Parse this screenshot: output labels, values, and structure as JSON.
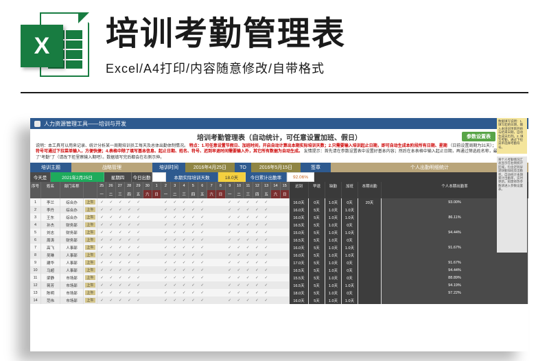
{
  "header": {
    "title": "培训考勤管理表",
    "subtitle": "Excel/A4打印/内容随意修改/自带格式",
    "badge": "X"
  },
  "ribbon": {
    "text": "人力资源管理工具——培训与开发"
  },
  "doc": {
    "title": "培训考勤管理表（自动统计，可任意设置加班、假日）",
    "param_btn": "参数设置表",
    "desc_prefix": "说明：本工具可以用来记录、统计分析某一周期培训员工每天及总体出勤体制情况。",
    "desc_bold": "特点：1.可任意设置节假日、加班时间，开启自动计算出本期实际培训天数；2.只需要输入培训起止日期，即可自动生成本阶段所有日期、星期",
    "desc_mid": "（日前设置周期为31天）；",
    "desc_bold2": "3.姓名、考勤符号可通过下拉菜单输入，方便快捷；4.表格中除了填写基本信息、起止日期、姓名、符号、迟到早退时间需要输入外，其它所有数据为自动生成。",
    "desc_tail": "友情提示：首先请在参数设置表中设置好基本内容；然后在本表格中输入起止日期，再通过筛选姓名称，最后因温情记住了\"考勤\"了（请改下拒里察输入期吧）。数据填写完后都会在右侧示伸。"
  },
  "bands": {
    "topic": "培训主题",
    "plan": "战略管理",
    "time": "培训时间",
    "start": "2016年4月25日",
    "to": "TO",
    "end": "2016年5月15日",
    "sign": "签章",
    "stats": "个人出勤明细统计"
  },
  "dates": {
    "today_lbl": "今天是",
    "today": "2021年2月25日",
    "weekday": "星期四",
    "today_att": "今日出勤",
    "month_actual": "本期实际培训天数",
    "days": "18.0天",
    "rate_lbl": "今日累计出勤率",
    "rate": "92.06%"
  },
  "cols": {
    "idx": "序号",
    "name": "姓名",
    "dept": "部门名称",
    "days_hdr": [
      "25",
      "26",
      "27",
      "28",
      "29",
      "30",
      "1",
      "2",
      "3",
      "4",
      "5",
      "6",
      "7",
      "8",
      "9",
      "10",
      "11",
      "12",
      "13",
      "14",
      "15"
    ],
    "wk": [
      "一",
      "二",
      "三",
      "四",
      "五",
      "六",
      "日",
      "一",
      "二",
      "三",
      "四",
      "五",
      "六",
      "日",
      "一",
      "二",
      "三",
      "四",
      "五",
      "六",
      "日"
    ],
    "late": "迟到",
    "early": "早退",
    "absent": "缺勤",
    "ot": "加班",
    "actual": "本期出勤",
    "prate": "个人本期出勤率"
  },
  "rows": [
    {
      "idx": "1",
      "name": "李兰",
      "dept": "综合办",
      "tag": "上午",
      "late": "16.0天",
      "early": "0天",
      "absent": "1.0天",
      "ot": "0天",
      "actual": "20天",
      "rate": "93.00%"
    },
    {
      "idx": "2",
      "name": "李丹",
      "dept": "综合办",
      "tag": "上午",
      "late": "16.0天",
      "early": "5天",
      "absent": "1.0天",
      "ot": "1.0天",
      "actual": "",
      "rate": ""
    },
    {
      "idx": "3",
      "name": "王东",
      "dept": "综合办",
      "tag": "上午",
      "late": "16.0天",
      "early": "5天",
      "absent": "1.0天",
      "ot": "1.0天",
      "actual": "",
      "rate": "86.11%"
    },
    {
      "idx": "4",
      "name": "孙杰",
      "dept": "财务部",
      "tag": "上午",
      "late": "16.5天",
      "early": "5天",
      "absent": "1.0天",
      "ot": "0天",
      "actual": "",
      "rate": ""
    },
    {
      "idx": "5",
      "name": "刘志",
      "dept": "财务部",
      "tag": "上午",
      "late": "15.0天",
      "early": "5天",
      "absent": "1.0天",
      "ot": "1.0天",
      "actual": "",
      "rate": "94.44%"
    },
    {
      "idx": "6",
      "name": "周涛",
      "dept": "财务部",
      "tag": "上午",
      "late": "16.5天",
      "early": "5天",
      "absent": "1.0天",
      "ot": "0天",
      "actual": "",
      "rate": ""
    },
    {
      "idx": "7",
      "name": "高飞",
      "dept": "人事部",
      "tag": "上午",
      "late": "16.0天",
      "early": "5天",
      "absent": "1.0天",
      "ot": "1.0天",
      "actual": "",
      "rate": "91.67%"
    },
    {
      "idx": "8",
      "name": "吴琳",
      "dept": "人事部",
      "tag": "上午",
      "late": "16.0天",
      "early": "5天",
      "absent": "1.0天",
      "ot": "1.0天",
      "actual": "",
      "rate": ""
    },
    {
      "idx": "9",
      "name": "建华",
      "dept": "人事部",
      "tag": "上午",
      "late": "17.0天",
      "early": "5天",
      "absent": "1.0天",
      "ot": "0天",
      "actual": "",
      "rate": "91.67%"
    },
    {
      "idx": "10",
      "name": "马超",
      "dept": "人事部",
      "tag": "上午",
      "late": "16.5天",
      "early": "5天",
      "absent": "1.0天",
      "ot": "0天",
      "actual": "",
      "rate": "94.44%"
    },
    {
      "idx": "11",
      "name": "梁静",
      "dept": "市场部",
      "tag": "上午",
      "late": "15.5天",
      "early": "5天",
      "absent": "1.0天",
      "ot": "0天",
      "actual": "",
      "rate": "88.89%"
    },
    {
      "idx": "12",
      "name": "蒋芳",
      "dept": "市场部",
      "tag": "上午",
      "late": "16.5天",
      "early": "5天",
      "absent": "1.0天",
      "ot": "1.0天",
      "actual": "",
      "rate": "94.19%"
    },
    {
      "idx": "13",
      "name": "陈明",
      "dept": "市场部",
      "tag": "上午",
      "late": "18.0天",
      "early": "5天",
      "absent": "1.0天",
      "ot": "0天",
      "actual": "",
      "rate": "97.22%"
    },
    {
      "idx": "14",
      "name": "范伟",
      "dept": "市场部",
      "tag": "上午",
      "late": "16.0天",
      "early": "5天",
      "absent": "1.0天",
      "ot": "1.0天",
      "actual": "",
      "rate": ""
    }
  ],
  "notes1": "数据填写说明：1. 填写起始日期，输入本培训项目开始与结束日期，自动生成日历列。2. 填写考勤，通过下拉菜单选择考勤符号。",
  "notes2": "将个人考勤情况汇总显示在右侧统计区域，包含迟到早退缺勤加班及出勤率。自动统计本期累计出勤率，实时更新。如需修改参数请进入参数设置表。"
}
